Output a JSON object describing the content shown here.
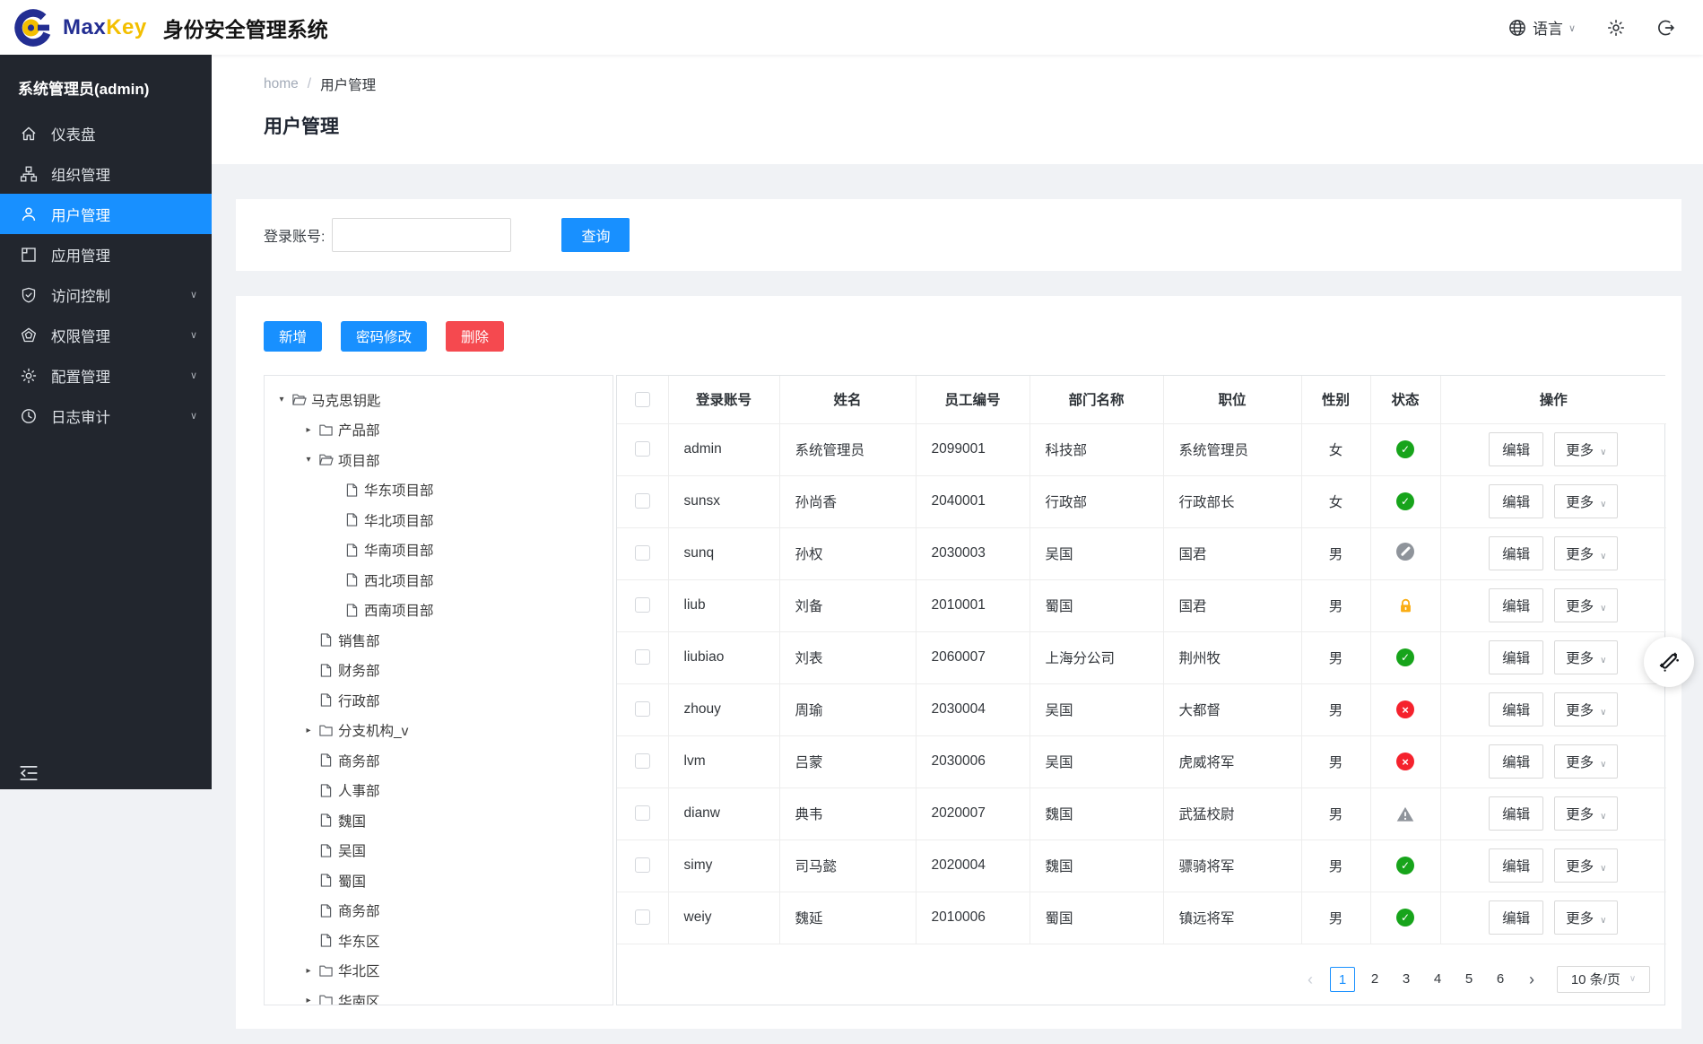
{
  "colors": {
    "primary": "#1890ff",
    "danger": "#f5494f",
    "success": "#17a41b",
    "error": "#f5222d",
    "warning": "#faad14",
    "muted": "#9aa0a6",
    "sidebar_bg": "#22262e"
  },
  "icons": {
    "chevron_down": "∨",
    "caret_down": "▾",
    "caret_right": "▸",
    "prev": "‹",
    "next": "›"
  },
  "header": {
    "brand_max": "Max",
    "brand_key": "Key",
    "brand_title": "身份安全管理系统",
    "language": "语言"
  },
  "sidebar": {
    "user": "系统管理员(admin)",
    "items": [
      {
        "label": "仪表盘",
        "icon": "home",
        "name": "dashboard",
        "active": false,
        "children": false
      },
      {
        "label": "组织管理",
        "icon": "cluster",
        "name": "organizations",
        "active": false,
        "children": false
      },
      {
        "label": "用户管理",
        "icon": "user",
        "name": "users",
        "active": true,
        "children": false
      },
      {
        "label": "应用管理",
        "icon": "app",
        "name": "applications",
        "active": false,
        "children": false
      },
      {
        "label": "访问控制",
        "icon": "shield",
        "name": "access-control",
        "active": false,
        "children": true
      },
      {
        "label": "权限管理",
        "icon": "gem",
        "name": "permissions",
        "active": false,
        "children": true
      },
      {
        "label": "配置管理",
        "icon": "gear",
        "name": "configuration",
        "active": false,
        "children": true
      },
      {
        "label": "日志审计",
        "icon": "clock",
        "name": "audit-logs",
        "active": false,
        "children": true
      }
    ]
  },
  "breadcrumb": {
    "home": "home",
    "separator": "/",
    "current": "用户管理"
  },
  "page": {
    "title": "用户管理"
  },
  "search": {
    "label": "登录账号:",
    "value": "",
    "button": "查询"
  },
  "toolbar": {
    "add": "新增",
    "change_password": "密码修改",
    "delete": "删除"
  },
  "tree": {
    "nodes": [
      {
        "label": "马克思钥匙",
        "level": 0,
        "icon": "folderOpen",
        "caret": "down"
      },
      {
        "label": "产品部",
        "level": 1,
        "icon": "folder",
        "caret": "right"
      },
      {
        "label": "项目部",
        "level": 1,
        "icon": "folderOpen",
        "caret": "down"
      },
      {
        "label": "华东项目部",
        "level": 2,
        "icon": "file",
        "caret": "none"
      },
      {
        "label": "华北项目部",
        "level": 2,
        "icon": "file",
        "caret": "none"
      },
      {
        "label": "华南项目部",
        "level": 2,
        "icon": "file",
        "caret": "none"
      },
      {
        "label": "西北项目部",
        "level": 2,
        "icon": "file",
        "caret": "none"
      },
      {
        "label": "西南项目部",
        "level": 2,
        "icon": "file",
        "caret": "none"
      },
      {
        "label": "销售部",
        "level": 1,
        "icon": "file",
        "caret": "none"
      },
      {
        "label": "财务部",
        "level": 1,
        "icon": "file",
        "caret": "none"
      },
      {
        "label": "行政部",
        "level": 1,
        "icon": "file",
        "caret": "none"
      },
      {
        "label": "分支机构_v",
        "level": 1,
        "icon": "folder",
        "caret": "right"
      },
      {
        "label": "商务部",
        "level": 1,
        "icon": "file",
        "caret": "none"
      },
      {
        "label": "人事部",
        "level": 1,
        "icon": "file",
        "caret": "none"
      },
      {
        "label": "魏国",
        "level": 1,
        "icon": "file",
        "caret": "none"
      },
      {
        "label": "吴国",
        "level": 1,
        "icon": "file",
        "caret": "none"
      },
      {
        "label": "蜀国",
        "level": 1,
        "icon": "file",
        "caret": "none"
      },
      {
        "label": "商务部",
        "level": 1,
        "icon": "file",
        "caret": "none"
      },
      {
        "label": "华东区",
        "level": 1,
        "icon": "file",
        "caret": "none"
      },
      {
        "label": "华北区",
        "level": 1,
        "icon": "folder",
        "caret": "right"
      },
      {
        "label": "华南区",
        "level": 1,
        "icon": "folder",
        "caret": "right"
      }
    ]
  },
  "table": {
    "columns": [
      "登录账号",
      "姓名",
      "员工编号",
      "部门名称",
      "职位",
      "性别",
      "状态",
      "操作"
    ],
    "edit_label": "编辑",
    "more_label": "更多",
    "rows": [
      {
        "account": "admin",
        "name": "系统管理员",
        "employee_id": "2099001",
        "department": "科技部",
        "title": "系统管理员",
        "gender": "女",
        "status": "active"
      },
      {
        "account": "sunsx",
        "name": "孙尚香",
        "employee_id": "2040001",
        "department": "行政部",
        "title": "行政部长",
        "gender": "女",
        "status": "active"
      },
      {
        "account": "sunq",
        "name": "孙权",
        "employee_id": "2030003",
        "department": "吴国",
        "title": "国君",
        "gender": "男",
        "status": "disabled"
      },
      {
        "account": "liub",
        "name": "刘备",
        "employee_id": "2010001",
        "department": "蜀国",
        "title": "国君",
        "gender": "男",
        "status": "locked"
      },
      {
        "account": "liubiao",
        "name": "刘表",
        "employee_id": "2060007",
        "department": "上海分公司",
        "title": "荆州牧",
        "gender": "男",
        "status": "active"
      },
      {
        "account": "zhouy",
        "name": "周瑜",
        "employee_id": "2030004",
        "department": "吴国",
        "title": "大都督",
        "gender": "男",
        "status": "inactive"
      },
      {
        "account": "lvm",
        "name": "吕蒙",
        "employee_id": "2030006",
        "department": "吴国",
        "title": "虎威将军",
        "gender": "男",
        "status": "inactive"
      },
      {
        "account": "dianw",
        "name": "典韦",
        "employee_id": "2020007",
        "department": "魏国",
        "title": "武猛校尉",
        "gender": "男",
        "status": "warning"
      },
      {
        "account": "simy",
        "name": "司马懿",
        "employee_id": "2020004",
        "department": "魏国",
        "title": "骠骑将军",
        "gender": "男",
        "status": "active"
      },
      {
        "account": "weiy",
        "name": "魏延",
        "employee_id": "2010006",
        "department": "蜀国",
        "title": "镇远将军",
        "gender": "男",
        "status": "active"
      }
    ]
  },
  "pagination": {
    "pages": [
      "1",
      "2",
      "3",
      "4",
      "5",
      "6"
    ],
    "active": "1",
    "page_size": "10 条/页"
  }
}
